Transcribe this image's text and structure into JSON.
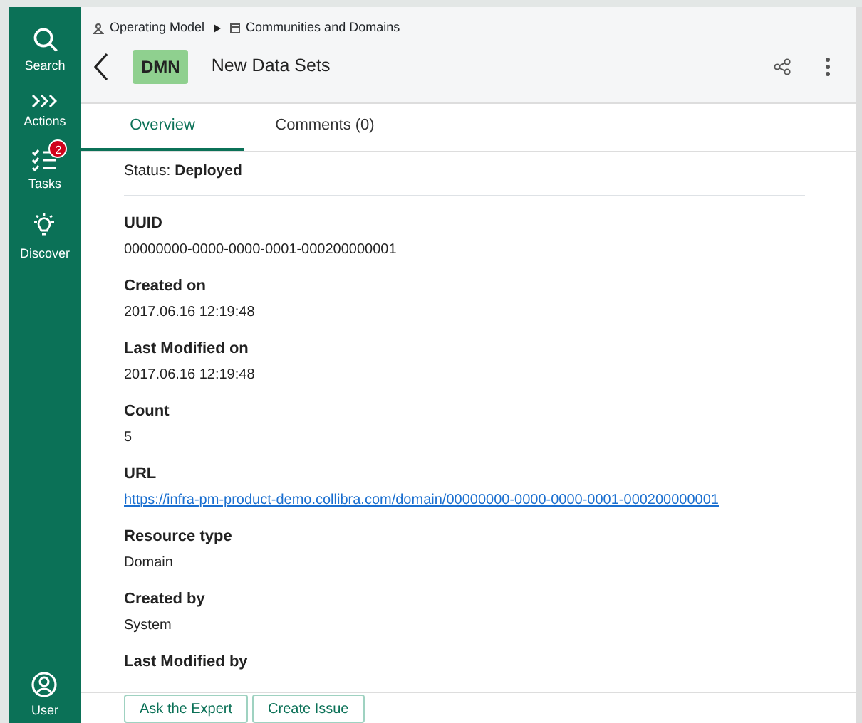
{
  "sidebar": {
    "items": [
      {
        "kind": "search",
        "label": "Search"
      },
      {
        "kind": "actions",
        "label": "Actions"
      },
      {
        "kind": "tasks",
        "label": "Tasks",
        "badge": "2"
      },
      {
        "kind": "discover",
        "label": "Discover"
      }
    ],
    "footer_item": {
      "kind": "user",
      "label": "User"
    }
  },
  "breadcrumb": [
    {
      "kind": "community",
      "label": "Operating Model"
    },
    {
      "kind": "domain",
      "label": "Communities and Domains"
    }
  ],
  "header": {
    "type_badge": "DMN",
    "title": "New Data Sets"
  },
  "tabs": [
    {
      "label": "Overview",
      "selected": true
    },
    {
      "label": "Comments (0)",
      "selected": false
    }
  ],
  "status": {
    "label": "Status:",
    "value": "Deployed"
  },
  "fields": [
    {
      "label": "UUID",
      "value": "00000000-0000-0000-0001-000200000001",
      "kind": "text"
    },
    {
      "label": "Created on",
      "value": "2017.06.16 12:19:48",
      "kind": "text"
    },
    {
      "label": "Last Modified on",
      "value": "2017.06.16 12:19:48",
      "kind": "text"
    },
    {
      "label": "Count",
      "value": "5",
      "kind": "text"
    },
    {
      "label": "URL",
      "value": "https://infra-pm-product-demo.collibra.com/domain/00000000-0000-0000-0001-000200000001",
      "kind": "link"
    },
    {
      "label": "Resource type",
      "value": "Domain",
      "kind": "text"
    },
    {
      "label": "Created by",
      "value": "System",
      "kind": "text"
    },
    {
      "label": "Last Modified by"
    }
  ],
  "footer_buttons": [
    "Ask the Expert",
    "Create Issue"
  ]
}
